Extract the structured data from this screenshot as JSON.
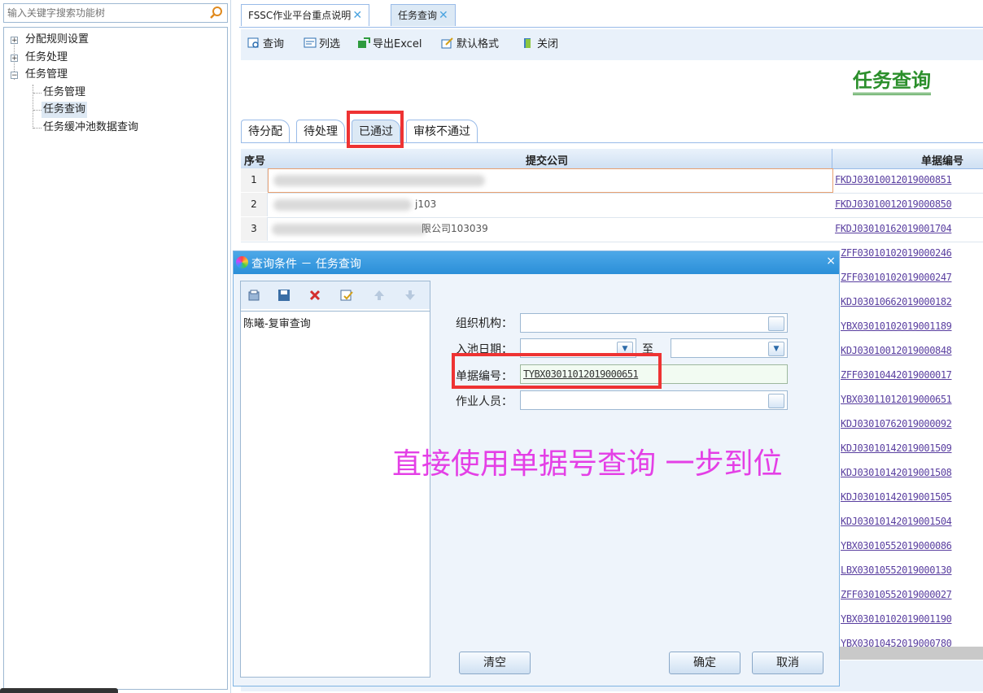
{
  "sidebar": {
    "search_placeholder": "输入关键字搜索功能树",
    "tree": [
      {
        "label": "分配规则设置",
        "expander": "+"
      },
      {
        "label": "任务处理",
        "expander": "+"
      },
      {
        "label": "任务管理",
        "expander": "−"
      },
      {
        "label": "任务管理"
      },
      {
        "label": "任务查询",
        "selected": true
      },
      {
        "label": "任务缓冲池数据查询"
      }
    ]
  },
  "tabs": [
    {
      "label": "FSSC作业平台重点说明",
      "close": "✕"
    },
    {
      "label": "任务查询",
      "close": "✕"
    }
  ],
  "toolbar": {
    "query": "查询",
    "columns": "列选",
    "export": "导出Excel",
    "default_format": "默认格式",
    "close": "关闭"
  },
  "page_title": "任务查询",
  "subtabs": [
    "待分配",
    "待处理",
    "已通过",
    "审核不通过"
  ],
  "grid": {
    "headers": {
      "no": "序号",
      "company": "提交公司",
      "bill_no": "单据编号"
    },
    "rows": [
      {
        "no": "1",
        "company": "",
        "bill_no": "FKDJ03010012019000851"
      },
      {
        "no": "2",
        "company": "j103",
        "bill_no": "FKDJ03010012019000850"
      },
      {
        "no": "3",
        "company": "限公司103039",
        "bill_no": "FKDJ03010162019001704"
      }
    ],
    "more_bill_nos": [
      "ZFF03010102019000246",
      "ZFF03010102019000247",
      "KDJ03010662019000182",
      "YBX03010102019001189",
      "KDJ03010012019000848",
      "ZFF03010442019000017",
      "YBX03011012019000651",
      "KDJ03010762019000092",
      "KDJ03010142019001509",
      "KDJ03010142019001508",
      "KDJ03010142019001505",
      "KDJ03010142019001504",
      "YBX03010552019000086",
      "LBX03010552019000130",
      "ZFF03010552019000027",
      "YBX03010102019001190",
      "YBX03010452019000780"
    ]
  },
  "dialog": {
    "title": "查询条件  －  任务查询",
    "close": "×",
    "saved_query": "陈曦-复审查询",
    "fields": {
      "org_label": "组织机构：",
      "date_label": "入池日期：",
      "date_to": "至",
      "bill_label": "单据编号：",
      "bill_value": "TYBX03011012019000651",
      "worker_label": "作业人员："
    },
    "buttons": {
      "clear": "清空",
      "ok": "确定",
      "cancel": "取消"
    }
  },
  "annotation": "直接使用单据号查询  一步到位",
  "colors": {
    "accent_blue": "#2b8fd8",
    "title_green": "#2b8f2b",
    "highlight_red": "#e33333",
    "annotation_magenta": "#e43fe6",
    "link_purple": "#5a3fa0"
  }
}
